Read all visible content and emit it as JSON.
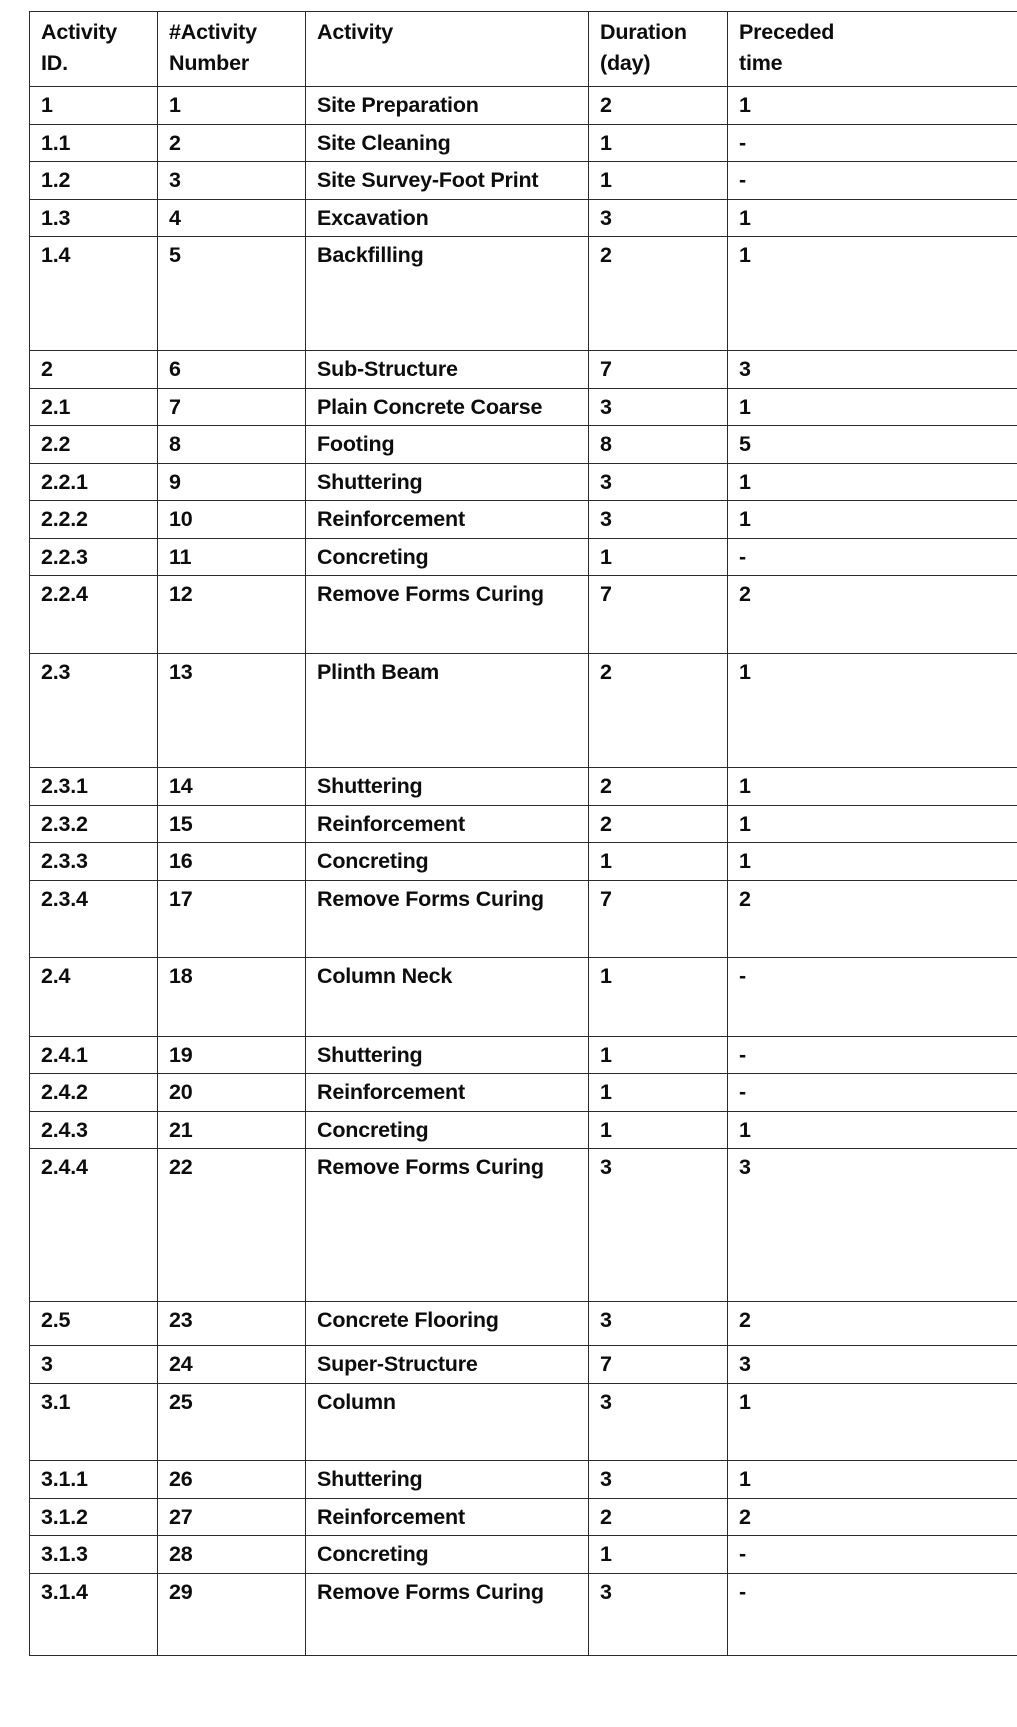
{
  "table": {
    "columns": [
      {
        "key": "activity_id",
        "label_lines": [
          "Activity",
          "ID."
        ],
        "color": "#0d0d0d"
      },
      {
        "key": "activity_num",
        "label_lines": [
          "#Activity",
          "Number"
        ],
        "color": "#0d0d0d"
      },
      {
        "key": "activity",
        "label_lines": [
          "Activity",
          ""
        ],
        "color": "#0d0d0d"
      },
      {
        "key": "duration",
        "label_lines": [
          "Duration",
          "(day)"
        ],
        "color": "#2e74b5"
      },
      {
        "key": "preceded_time",
        "label_lines": [
          "Preceded",
          "time"
        ],
        "color": "#9c4314"
      }
    ],
    "rows": [
      {
        "activity_id": "1",
        "activity_num": "1",
        "activity": "Site Preparation",
        "duration": "2",
        "preceded_time": "1",
        "height_class": "r-std"
      },
      {
        "activity_id": "1.1",
        "activity_num": "2",
        "activity": "Site Cleaning",
        "duration": "1",
        "preceded_time": "-",
        "height_class": "r-std"
      },
      {
        "activity_id": "1.2",
        "activity_num": "3",
        "activity": "Site Survey-Foot Print",
        "duration": "1",
        "preceded_time": "-",
        "height_class": "r-std"
      },
      {
        "activity_id": "1.3",
        "activity_num": "4",
        "activity": "Excavation",
        "duration": "3",
        "preceded_time": "1",
        "height_class": "r-std"
      },
      {
        "activity_id": "1.4",
        "activity_num": "5",
        "activity": "Backfilling",
        "duration": "2",
        "preceded_time": "1",
        "height_class": "r-t114"
      },
      {
        "activity_id": "2",
        "activity_num": "6",
        "activity": "Sub-Structure",
        "duration": "7",
        "preceded_time": "3",
        "height_class": "r-std"
      },
      {
        "activity_id": "2.1",
        "activity_num": "7",
        "activity": "Plain Concrete Coarse",
        "duration": "3",
        "preceded_time": "1",
        "height_class": "r-std"
      },
      {
        "activity_id": "2.2",
        "activity_num": "8",
        "activity": "Footing",
        "duration": "8",
        "preceded_time": "5",
        "height_class": "r-std"
      },
      {
        "activity_id": "2.2.1",
        "activity_num": "9",
        "activity": "Shuttering",
        "duration": "3",
        "preceded_time": "1",
        "height_class": "r-std"
      },
      {
        "activity_id": "2.2.2",
        "activity_num": "10",
        "activity": "Reinforcement",
        "duration": "3",
        "preceded_time": "1",
        "height_class": "r-std"
      },
      {
        "activity_id": "2.2.3",
        "activity_num": "11",
        "activity": "Concreting",
        "duration": "1",
        "preceded_time": "-",
        "height_class": "r-std"
      },
      {
        "activity_id": "2.2.4",
        "activity_num": "12",
        "activity": "Remove Forms Curing",
        "duration": "7",
        "preceded_time": "2",
        "height_class": "r-t78"
      },
      {
        "activity_id": "2.3",
        "activity_num": "13",
        "activity": "Plinth Beam",
        "duration": "2",
        "preceded_time": "1",
        "height_class": "r-t114"
      },
      {
        "activity_id": "2.3.1",
        "activity_num": "14",
        "activity": "Shuttering",
        "duration": "2",
        "preceded_time": "1",
        "height_class": "r-std"
      },
      {
        "activity_id": "2.3.2",
        "activity_num": "15",
        "activity": "Reinforcement",
        "duration": "2",
        "preceded_time": "1",
        "height_class": "r-std"
      },
      {
        "activity_id": "2.3.3",
        "activity_num": "16",
        "activity": "Concreting",
        "duration": "1",
        "preceded_time": "1",
        "height_class": "r-std"
      },
      {
        "activity_id": "2.3.4",
        "activity_num": "17",
        "activity": "Remove Forms Curing",
        "duration": "7",
        "preceded_time": "2",
        "height_class": "r-t77"
      },
      {
        "activity_id": "2.4",
        "activity_num": "18",
        "activity": "Column Neck",
        "duration": "1",
        "preceded_time": "-",
        "height_class": "r-t79"
      },
      {
        "activity_id": "2.4.1",
        "activity_num": "19",
        "activity": "Shuttering",
        "duration": "1",
        "preceded_time": "-",
        "height_class": "r-std"
      },
      {
        "activity_id": "2.4.2",
        "activity_num": "20",
        "activity": "Reinforcement",
        "duration": "1",
        "preceded_time": "-",
        "height_class": "r-std"
      },
      {
        "activity_id": "2.4.3",
        "activity_num": "21",
        "activity": "Concreting",
        "duration": "1",
        "preceded_time": "1",
        "height_class": "r-std"
      },
      {
        "activity_id": "2.4.4",
        "activity_num": "22",
        "activity": "Remove Forms Curing",
        "duration": "3",
        "preceded_time": "3",
        "height_class": "r-t153"
      },
      {
        "activity_id": "2.5",
        "activity_num": "23",
        "activity": "Concrete Flooring",
        "duration": "3",
        "preceded_time": "2",
        "height_class": "r-t44"
      },
      {
        "activity_id": "3",
        "activity_num": "24",
        "activity": "Super-Structure",
        "duration": "7",
        "preceded_time": "3",
        "height_class": "r-t38"
      },
      {
        "activity_id": "3.1",
        "activity_num": "25",
        "activity": "Column",
        "duration": "3",
        "preceded_time": "1",
        "height_class": "r-t77"
      },
      {
        "activity_id": "3.1.1",
        "activity_num": "26",
        "activity": "Shuttering",
        "duration": "3",
        "preceded_time": "1",
        "height_class": "r-std"
      },
      {
        "activity_id": "3.1.2",
        "activity_num": "27",
        "activity": "Reinforcement",
        "duration": "2",
        "preceded_time": "2",
        "height_class": "r-std"
      },
      {
        "activity_id": "3.1.3",
        "activity_num": "28",
        "activity": "Concreting",
        "duration": "1",
        "preceded_time": "-",
        "height_class": "r-t38b"
      },
      {
        "activity_id": "3.1.4",
        "activity_num": "29",
        "activity": "Remove Forms Curing",
        "duration": "3",
        "preceded_time": "-",
        "height_class": "r-t82"
      }
    ]
  },
  "colors": {
    "text": "#0d0d0d",
    "duration_accent": "#2e74b5",
    "preceded_accent": "#9c4314",
    "border": "#2b2b2b",
    "background": "#ffffff"
  }
}
